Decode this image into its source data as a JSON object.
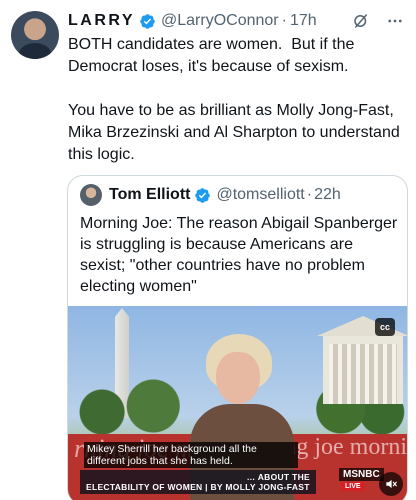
{
  "tweet": {
    "author_name": "LARRY",
    "handle": "@LarryOConnor",
    "separator": "·",
    "time": "17h",
    "text": "BOTH candidates are women.  But if the Democrat loses, it's because of sexism.\n\nYou have to be as brilliant as Molly Jong-Fast, Mika Brzezinski and Al Sharpton to understand this logic."
  },
  "quote": {
    "author_name": "Tom Elliott",
    "handle": "@tomselliott",
    "separator": "·",
    "time": "22h",
    "text": "Morning Joe: The reason Abigail Spanberger is struggling is because Americans are sexist; \"other countries have no problem electing women\""
  },
  "video": {
    "cc_label": "cc",
    "caption": "Mikey Sherrill her background all the different jobs that she has held.",
    "lower_third": "ELECTABILITY OF WOMEN | BY MOLLY JONG-FAST",
    "lower_third_top": "… ABOUT THE",
    "network": "MSNBC",
    "live": "LIVE",
    "desk_left": "rning joe m",
    "desk_right": "ng joe morni"
  },
  "colors": {
    "text": "#0f1419",
    "secondary": "#536471",
    "verified": "#1d9bf0",
    "border": "#cfd9de"
  },
  "icons": [
    "verified-badge-icon",
    "grok-icon",
    "more-icon",
    "cc-icon",
    "mute-icon"
  ]
}
